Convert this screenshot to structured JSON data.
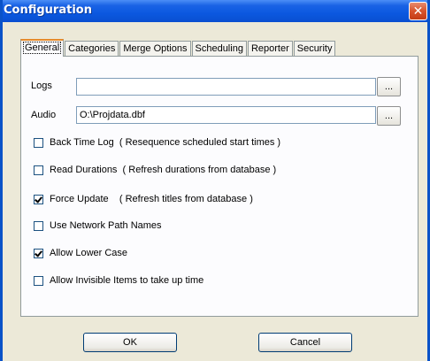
{
  "window": {
    "title": "Configuration",
    "close_glyph": "✕"
  },
  "tabs": [
    {
      "label": "General",
      "active": true
    },
    {
      "label": "Categories"
    },
    {
      "label": "Merge Options"
    },
    {
      "label": "Scheduling"
    },
    {
      "label": "Reporter"
    },
    {
      "label": "Security"
    }
  ],
  "fields": {
    "logs": {
      "label": "Logs",
      "value": ""
    },
    "audio": {
      "label": "Audio",
      "value": "O:\\Projdata.dbf"
    },
    "browse_label": "..."
  },
  "options": [
    {
      "label": "Back Time Log  ( Resequence scheduled start times )",
      "checked": false
    },
    {
      "label": "Read Durations  ( Refresh durations from database )",
      "checked": false
    },
    {
      "label": "Force Update    ( Refresh titles from database )",
      "checked": true
    },
    {
      "label": "Use Network Path Names",
      "checked": false
    },
    {
      "label": "Allow Lower Case",
      "checked": true
    },
    {
      "label": "Allow Invisible Items to take up time",
      "checked": false
    }
  ],
  "buttons": {
    "ok": "OK",
    "cancel": "Cancel"
  }
}
